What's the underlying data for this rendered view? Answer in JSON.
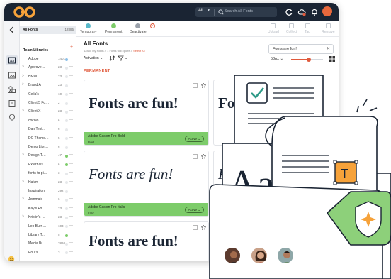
{
  "topbar": {
    "search_scope": "All",
    "search_placeholder": "Search All Fonts"
  },
  "sidebar": {
    "all_fonts_label": "All Fonts",
    "all_fonts_count": "12885",
    "team_libraries_label": "Team Libraries",
    "libraries": [
      {
        "name": "Adobe",
        "count": "1401",
        "expand": "",
        "dot": "#8cc0e8"
      },
      {
        "name": "Approve…",
        "count": "23",
        "expand": ">",
        "dot": "#e6e8eb"
      },
      {
        "name": "BMW",
        "count": "23",
        "expand": ">",
        "dot": "#e6e8eb"
      },
      {
        "name": "Brand A",
        "count": "23",
        "expand": ">",
        "dot": "#e6e8eb"
      },
      {
        "name": "Celia's",
        "count": "10",
        "expand": "",
        "dot": "#e6e8eb"
      },
      {
        "name": "Client 5 Fo…",
        "count": "2",
        "expand": "",
        "dot": "#e6e8eb"
      },
      {
        "name": "Client X",
        "count": "23",
        "expand": ">",
        "dot": "#e6e8eb"
      },
      {
        "name": "cocolo",
        "count": "6",
        "expand": "",
        "dot": "#e6e8eb"
      },
      {
        "name": "Dan Test…",
        "count": "6",
        "expand": "",
        "dot": "#e6e8eb"
      },
      {
        "name": "DC Thoms…",
        "count": "5",
        "expand": "",
        "dot": "#e6e8eb"
      },
      {
        "name": "Demo Libr…",
        "count": "6",
        "expand": "",
        "dot": "#e6e8eb"
      },
      {
        "name": "Design T…",
        "count": "47",
        "expand": ">",
        "dot": "#7dcc6a"
      },
      {
        "name": "Externals…",
        "count": "6",
        "expand": "",
        "dot": "#7dcc6a"
      },
      {
        "name": "fonts to pi…",
        "count": "3",
        "expand": "",
        "dot": "#e6e8eb"
      },
      {
        "name": "Hakim",
        "count": "23",
        "expand": ">",
        "dot": "#e6e8eb"
      },
      {
        "name": "Inspiration",
        "count": "292",
        "expand": "",
        "dot": "#e6e8eb"
      },
      {
        "name": "Jemma's",
        "count": "6",
        "expand": ">",
        "dot": "#e6e8eb"
      },
      {
        "name": "Kay's Fo…",
        "count": "23",
        "expand": "",
        "dot": "#e6e8eb"
      },
      {
        "name": "Kristin's …",
        "count": "23",
        "expand": ">",
        "dot": "#e6e8eb"
      },
      {
        "name": "Leo Burn…",
        "count": "103",
        "expand": "",
        "dot": "#e6e8eb"
      },
      {
        "name": "Library T…",
        "count": "5",
        "expand": "",
        "dot": "#7dcc6a"
      },
      {
        "name": "Media Br…",
        "count": "2810",
        "expand": "",
        "dot": "#e6e8eb"
      },
      {
        "name": "Poul's T",
        "count": "3",
        "expand": "",
        "dot": "#e6e8eb"
      }
    ],
    "dash": "—"
  },
  "toolbar": {
    "buttons": [
      {
        "label": "Temporary",
        "color": "#59b8c9"
      },
      {
        "label": "Permanent",
        "color": "#7dcc6a"
      },
      {
        "label": "Deactivate",
        "color": "#9aa1ab"
      }
    ],
    "right_buttons": [
      "Upload",
      "Collect",
      "Tag",
      "Remove"
    ]
  },
  "main": {
    "title": "All Fonts",
    "subtitle_prefix": "12885 My Fonts // 1 Fonts to Explore // ",
    "subtitle_link": "Select All",
    "activation_label": "Activation",
    "search_value": "Fonts are fun!",
    "size_label": "53px",
    "size_fraction": 0.55,
    "section_label": "PERMANENT"
  },
  "cards": [
    {
      "sample": "Fonts are fun!",
      "name": "Adobe Caslon Pro Bold",
      "style": "Bold",
      "status": "Active ⌄",
      "italic": false,
      "bold": true
    },
    {
      "sample": "Fonts are fun!",
      "name": "Adobe Caslon Pro Italic",
      "style": "Italic",
      "status": "Active ⌄",
      "italic": true,
      "bold": false
    },
    {
      "sample": "Fonts are fun!",
      "name": "",
      "style": "",
      "status": "",
      "italic": false,
      "bold": true
    }
  ],
  "right_cards": [
    {
      "sample": "Fo"
    },
    {
      "sample": "Fo"
    }
  ],
  "illustration": {
    "glyph": "Aa",
    "type_icon": "T",
    "colors": {
      "accent": "#e05a3c",
      "green": "#7dcc6a",
      "orange": "#f6a23a",
      "check": "#2e9a87",
      "shield": "#8dd07a"
    }
  },
  "icons": {
    "logo": "brand-logo-icon",
    "search": "search-icon",
    "sync": "sync-icon",
    "cloud": "cloud-icon",
    "bell": "bell-icon"
  }
}
